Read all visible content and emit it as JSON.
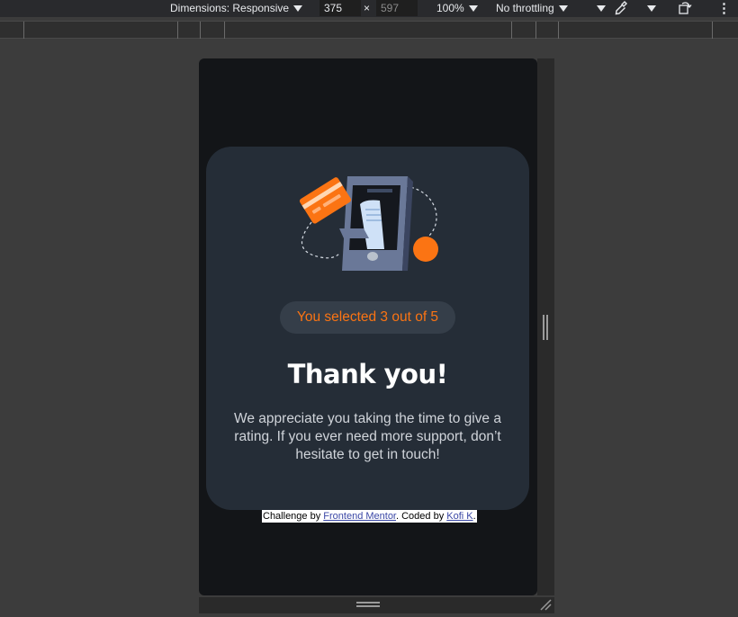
{
  "devtools": {
    "dimensions_label": "Dimensions: Responsive",
    "width_value": "375",
    "times_symbol": "×",
    "height_value": "597",
    "zoom_label": "100%",
    "throttling_label": "No throttling",
    "more_symbol": "⋮"
  },
  "page": {
    "rating_selected": 3,
    "rating_max": 5,
    "selection_text": "You selected 3 out of 5",
    "title": "Thank you!",
    "description": "We appreciate you taking the time to give a rating. If you ever need more support, don’t hesitate to get in touch!"
  },
  "attribution": {
    "prefix": "Challenge by ",
    "link1": "Frontend Mentor",
    "middle": ". Coded by ",
    "link2": "Kofi K",
    "suffix": "."
  },
  "colors": {
    "accent_orange": "#fb7413",
    "card_bg": "#252d37",
    "page_bg": "#131518",
    "pill_bg": "#353e49",
    "devtools_bg": "#292a2d",
    "canvas_bg": "#3c3c3c"
  },
  "icons": [
    "dropdown-arrow-icon",
    "eyedropper-icon",
    "rotate-icon",
    "more-options-icon",
    "resize-grip-icon",
    "payment-illustration-icon"
  ]
}
